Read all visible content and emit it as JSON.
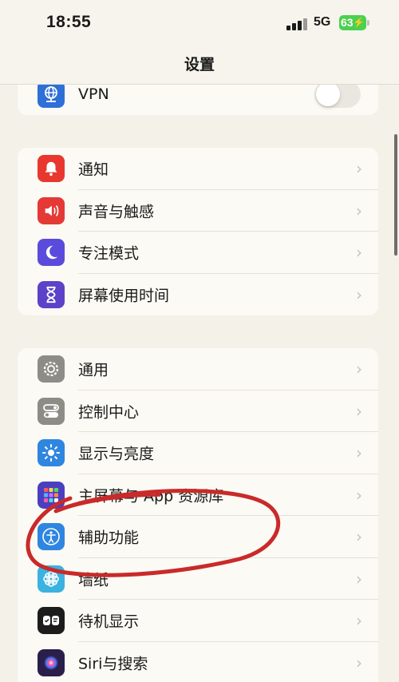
{
  "status_bar": {
    "time": "18:55",
    "network": "5G",
    "battery_level": "63"
  },
  "nav": {
    "title": "设置"
  },
  "groups": [
    {
      "items": [
        {
          "label": "VPN",
          "icon": "vpn-icon",
          "color": "#2e6fd8",
          "control": "toggle",
          "toggle_on": false
        }
      ]
    },
    {
      "items": [
        {
          "label": "通知",
          "icon": "bell-icon",
          "color": "#e8372f"
        },
        {
          "label": "声音与触感",
          "icon": "speaker-icon",
          "color": "#e53935"
        },
        {
          "label": "专注模式",
          "icon": "moon-icon",
          "color": "#5b4bdc"
        },
        {
          "label": "屏幕使用时间",
          "icon": "hourglass-icon",
          "color": "#5b42c8"
        }
      ]
    },
    {
      "items": [
        {
          "label": "通用",
          "icon": "gear-icon",
          "color": "#8e8c87"
        },
        {
          "label": "控制中心",
          "icon": "toggles-icon",
          "color": "#8e8c87"
        },
        {
          "label": "显示与亮度",
          "icon": "sun-icon",
          "color": "#2e86e0"
        },
        {
          "label": "主屏幕与 App 资源库",
          "icon": "app-grid-icon",
          "color": "#4a3fbf"
        },
        {
          "label": "辅助功能",
          "icon": "accessibility-icon",
          "color": "#2e86e0"
        },
        {
          "label": "墙纸",
          "icon": "wallpaper-icon",
          "color": "#3bb2e0"
        },
        {
          "label": "待机显示",
          "icon": "standby-icon",
          "color": "#1c1c1c"
        },
        {
          "label": "Siri与搜索",
          "icon": "siri-icon",
          "color": "#2a1f4a"
        }
      ]
    }
  ],
  "annotation": {
    "color": "#c92a2a",
    "shape": "hand-drawn-circle",
    "target": "辅助功能"
  }
}
